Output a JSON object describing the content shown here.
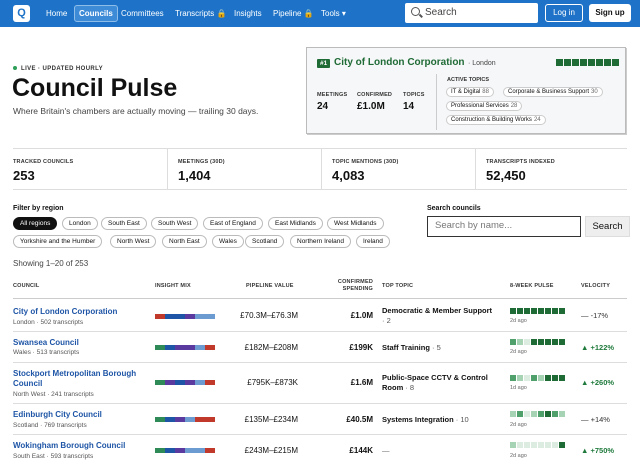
{
  "nav": {
    "logo": "Q",
    "items": [
      {
        "label": "Home"
      },
      {
        "label": "Councils"
      },
      {
        "label": "Committees"
      },
      {
        "label": "Transcripts 🔒"
      },
      {
        "label": "Insights"
      },
      {
        "label": "Pipeline 🔒"
      },
      {
        "label": "Tools ▾"
      }
    ],
    "search_placeholder": "Search",
    "login": "Log in",
    "signup": "Sign up"
  },
  "hero": {
    "live_label": "LIVE · UPDATED HOURLY",
    "title": "Council Pulse",
    "subtitle": "Where Britain's chambers are actually moving — trailing 30 days."
  },
  "featured": {
    "rank": "#1",
    "name": "City of London Corporation",
    "region": "· London",
    "stats": [
      {
        "label": "MEETINGS",
        "value": "24"
      },
      {
        "label": "CONFIRMED",
        "value": "£1.0M"
      },
      {
        "label": "TOPICS",
        "value": "14"
      }
    ],
    "topics_label": "ACTIVE TOPICS",
    "topics": [
      {
        "name": "IT & Digital",
        "count": "88"
      },
      {
        "name": "Corporate & Business Support",
        "count": "30"
      },
      {
        "name": "Professional Services",
        "count": "28"
      },
      {
        "name": "Construction & Building Works",
        "count": "24"
      }
    ],
    "spark_color": "#1f6b36"
  },
  "tiles": [
    {
      "label": "TRACKED COUNCILS",
      "value": "253"
    },
    {
      "label": "MEETINGS (30D)",
      "value": "1,404"
    },
    {
      "label": "TOPIC MENTIONS (30D)",
      "value": "4,083"
    },
    {
      "label": "TRANSCRIPTS INDEXED",
      "value": "52,450"
    }
  ],
  "filter": {
    "label": "Filter by region",
    "regions": [
      "All regions",
      "London",
      "South East",
      "South West",
      "East of England",
      "East Midlands",
      "West Midlands",
      "Yorkshire and the Humber",
      "North West",
      "North East",
      "Wales",
      "Scotland",
      "Northern Ireland",
      "Ireland"
    ],
    "selected": "All regions"
  },
  "search_councils": {
    "label": "Search councils",
    "placeholder": "Search by name...",
    "button": "Search"
  },
  "showing": "Showing 1–20 of 253",
  "table": {
    "headers": {
      "council": "COUNCIL",
      "insight": "INSIGHT MIX",
      "pipeline": "PIPELINE VALUE",
      "spending": "CONFIRMED SPENDING",
      "topic": "TOP TOPIC",
      "pulse": "8-WEEK PULSE",
      "velocity": "VELOCITY"
    },
    "mix_colors": [
      "#c0392b",
      "#2e8b57",
      "#1e55a6",
      "#5b3aa0",
      "#6b9bd1"
    ],
    "pulse_colors": {
      "strong": "#1f6b36",
      "mid": "#4fa06a",
      "light": "#a6d3b4",
      "faint": "#dcece1"
    },
    "rows": [
      {
        "name": "City of London Corporation",
        "meta": "London · 502 transcripts",
        "mix": [
          0,
          2,
          2,
          3,
          4,
          4
        ],
        "pipeline": "£70.3M–£76.3M",
        "spending": "£1.0M",
        "topic": "Democratic & Member Support",
        "topic_count": "· 2",
        "pulse": [
          "strong",
          "strong",
          "strong",
          "strong",
          "strong",
          "strong",
          "strong",
          "strong"
        ],
        "ago": "2d ago",
        "velocity": "— -17%",
        "trend": "flat"
      },
      {
        "name": "Swansea Council",
        "meta": "Wales · 513 transcripts",
        "mix": [
          1,
          2,
          3,
          3,
          4,
          0
        ],
        "pipeline": "£182M–£208M",
        "spending": "£199K",
        "topic": "Staff Training",
        "topic_count": "· 5",
        "pulse": [
          "mid",
          "light",
          "faint",
          "strong",
          "strong",
          "strong",
          "strong",
          "strong"
        ],
        "ago": "2d ago",
        "velocity": "▲ +122%",
        "trend": "up"
      },
      {
        "name": "Stockport Metropolitan Borough Council",
        "meta": "North West · 241 transcripts",
        "mix": [
          1,
          3,
          2,
          3,
          4,
          0
        ],
        "pipeline": "£795K–£873K",
        "spending": "£1.6M",
        "topic": "Public-Space CCTV & Control Room",
        "topic_count": "· 8",
        "pulse": [
          "mid",
          "light",
          "faint",
          "mid",
          "light",
          "strong",
          "strong",
          "strong"
        ],
        "ago": "1d ago",
        "velocity": "▲ +260%",
        "trend": "up"
      },
      {
        "name": "Edinburgh City Council",
        "meta": "Scotland · 769 transcripts",
        "mix": [
          1,
          2,
          3,
          4,
          0,
          0
        ],
        "pipeline": "£135M–£234M",
        "spending": "£40.5M",
        "topic": "Systems Integration",
        "topic_count": "· 10",
        "pulse": [
          "light",
          "mid",
          "faint",
          "light",
          "mid",
          "strong",
          "mid",
          "light"
        ],
        "ago": "2d ago",
        "velocity": "— +14%",
        "trend": "flat"
      },
      {
        "name": "Wokingham Borough Council",
        "meta": "South East · 593 transcripts",
        "mix": [
          1,
          2,
          3,
          4,
          4,
          0
        ],
        "pipeline": "£243M–£215M",
        "spending": "£144K",
        "topic": "—",
        "topic_count": "",
        "pulse": [
          "light",
          "faint",
          "faint",
          "faint",
          "faint",
          "faint",
          "faint",
          "strong"
        ],
        "ago": "2d ago",
        "velocity": "▲ +750%",
        "trend": "up"
      }
    ]
  }
}
